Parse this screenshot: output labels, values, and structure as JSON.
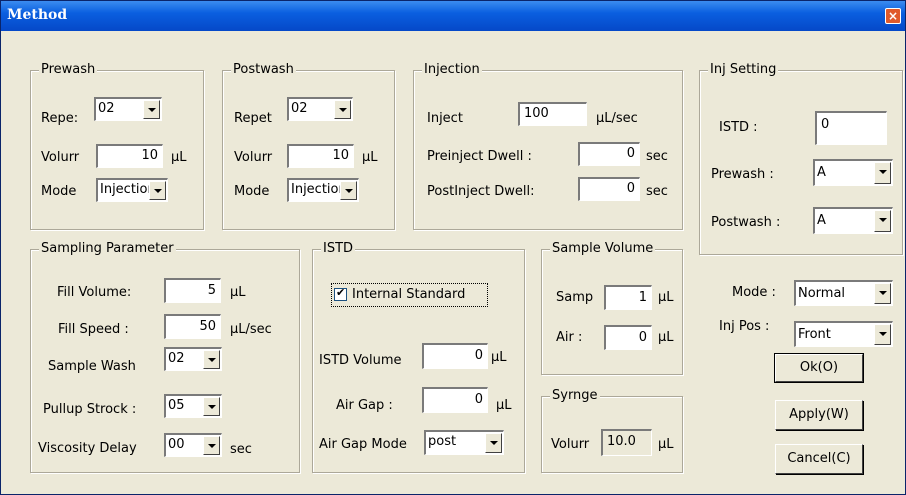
{
  "window": {
    "title": "Method",
    "close_glyph": "×"
  },
  "prewash": {
    "legend": "Prewash",
    "repeat_label": "Repe:",
    "repeat_value": "02",
    "volume_label": "Volurr",
    "volume_value": "10",
    "volume_unit": "µL",
    "mode_label": "Mode",
    "mode_value": "Injectior"
  },
  "postwash": {
    "legend": "Postwash",
    "repeat_label": "Repet",
    "repeat_value": "02",
    "volume_label": "Volurr",
    "volume_value": "10",
    "volume_unit": "µL",
    "mode_label": "Mode",
    "mode_value": "Injectior"
  },
  "injection": {
    "legend": "Injection",
    "inject_label": "Inject",
    "inject_value": "100",
    "inject_unit": "µL/sec",
    "preinject_label": "Preinject Dwell :",
    "preinject_value": "0",
    "preinject_unit": "sec",
    "postinject_label": "PostInject Dwell:",
    "postinject_value": "0",
    "postinject_unit": "sec"
  },
  "inj_setting": {
    "legend": "Inj Setting",
    "istd_label": "ISTD :",
    "istd_value": "0",
    "prewash_label": "Prewash :",
    "prewash_value": "A",
    "postwash_label": "Postwash :",
    "postwash_value": "A"
  },
  "sampling": {
    "legend": "Sampling Parameter",
    "fill_volume_label": "Fill Volume:",
    "fill_volume_value": "5",
    "fill_volume_unit": "µL",
    "fill_speed_label": "Fill Speed :",
    "fill_speed_value": "50",
    "fill_speed_unit": "µL/sec",
    "sample_wash_label": "Sample Wash",
    "sample_wash_value": "02",
    "pullup_label": "Pullup Strock :",
    "pullup_value": "05",
    "viscosity_label": "Viscosity  Delay",
    "viscosity_value": "00",
    "viscosity_unit": "sec"
  },
  "istd": {
    "legend": "ISTD",
    "internal_standard_label": "Internal Standard",
    "internal_standard_checked": true,
    "volume_label": "ISTD Volume",
    "volume_value": "0",
    "volume_unit": "µL",
    "air_gap_label": "Air Gap :",
    "air_gap_value": "0",
    "air_gap_unit": "µL",
    "air_gap_mode_label": "Air Gap Mode",
    "air_gap_mode_value": "post"
  },
  "sample_volume": {
    "legend": "Sample Volume",
    "samp_label": "Samp",
    "samp_value": "1",
    "samp_unit": "µL",
    "air_label": "Air :",
    "air_value": "0",
    "air_unit": "µL"
  },
  "syringe": {
    "legend": "Syrnge",
    "volume_label": "Volurr",
    "volume_value": "10.0",
    "volume_unit": "µL"
  },
  "right": {
    "mode_label": "Mode :",
    "mode_value": "Normal",
    "inj_pos_label": "Inj Pos :",
    "inj_pos_value": "Front",
    "ok_label": "Ok(O)",
    "apply_label": "Apply(W)",
    "cancel_label": "Cancel(C)"
  },
  "colors": {
    "title_bar": "#0a5fe0",
    "dialog_bg": "#ece9d8",
    "close_button": "#e05a2b"
  }
}
